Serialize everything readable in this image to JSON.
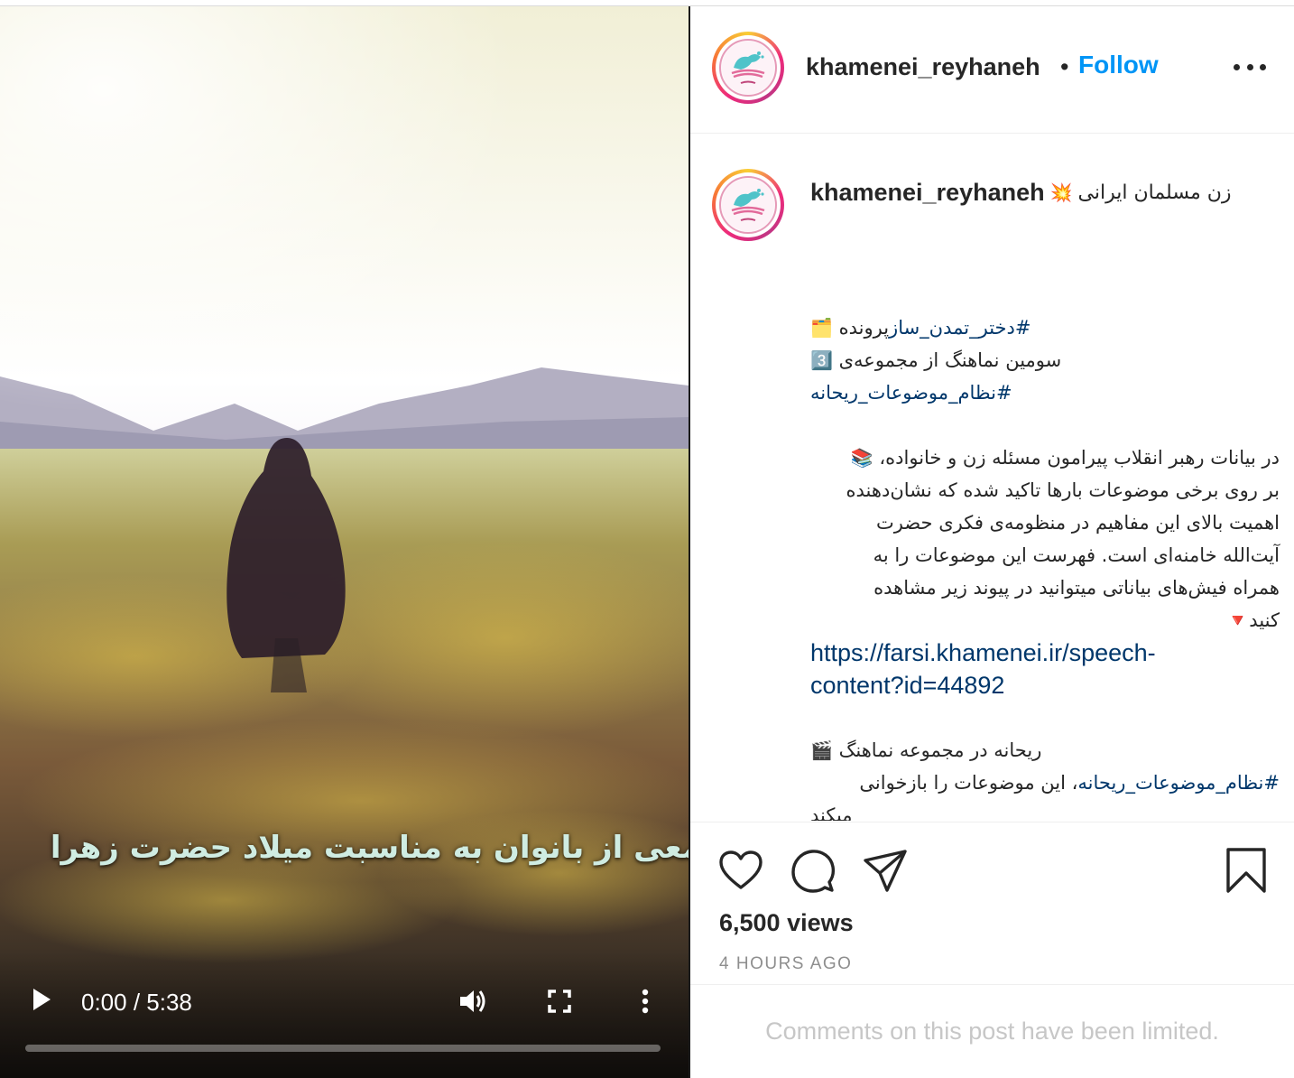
{
  "post": {
    "username": "khamenei_reyhaneh",
    "follow_label": "Follow",
    "separator": "•",
    "more_label": "More options",
    "avatar_alt": "khamenei_reyhaneh profile picture"
  },
  "video": {
    "overlay_text": "جمعی از بانوان به مناسبت میلاد حضرت زهرا",
    "current_time": "0:00",
    "duration": "5:38",
    "time_display": "0:00 / 5:38",
    "progress": 0
  },
  "caption": {
    "username": "khamenei_reyhaneh",
    "first_line": "زن مسلمان ایرانی",
    "first_line_emoji": "💥",
    "l1_prefix": "پرونده ",
    "l1_tag": "#دختر_تمدن_ساز",
    "l1_emoji": "🗂️",
    "l2_text": "سومین نماهنگ از مجموعه‌ی",
    "l2_emoji": "3️⃣",
    "l3_tag": "#نظام_موضوعات_ریحانه",
    "p2_emoji": "📚",
    "p2_line1": "در بیانات رهبر انقلاب پیرامون مسئله زن و خانواده،",
    "p2_line2": "بر روی برخی موضوعات بارها تاکید شده که نشان‌دهنده",
    "p2_line3": "اهمیت بالای این مفاهیم در منظومه‌ی فکری حضرت",
    "p2_line4": "آیت‌الله خامنه‌ای است. فهرست این موضوعات را به",
    "p2_line5": "همراه فیش‌های بیاناتی میتوانید در پیوند زیر مشاهده",
    "p2_line6": "کنید",
    "p2_line6_emoji": "🔻",
    "link_line1": "https://farsi.khamenei.ir/speech-",
    "link_line2": "content?id=44892",
    "p3_text": "ریحانه در مجموعه نماهنگ",
    "p3_emoji": "🎬",
    "p4_tag": "#نظام_موضوعات_ریحانه",
    "p4_text": "، این موضوعات را بازخوانی",
    "p5_text": "میکند"
  },
  "actions": {
    "views": "6,500 views",
    "time_ago": "4 HOURS AGO"
  },
  "comments": {
    "limited_text": "Comments on this post have been limited."
  },
  "colors": {
    "accent": "#0095f6",
    "hashtag": "#00376b",
    "text": "#262626",
    "muted": "#8e8e8e",
    "disabled": "#c7c7c7"
  }
}
